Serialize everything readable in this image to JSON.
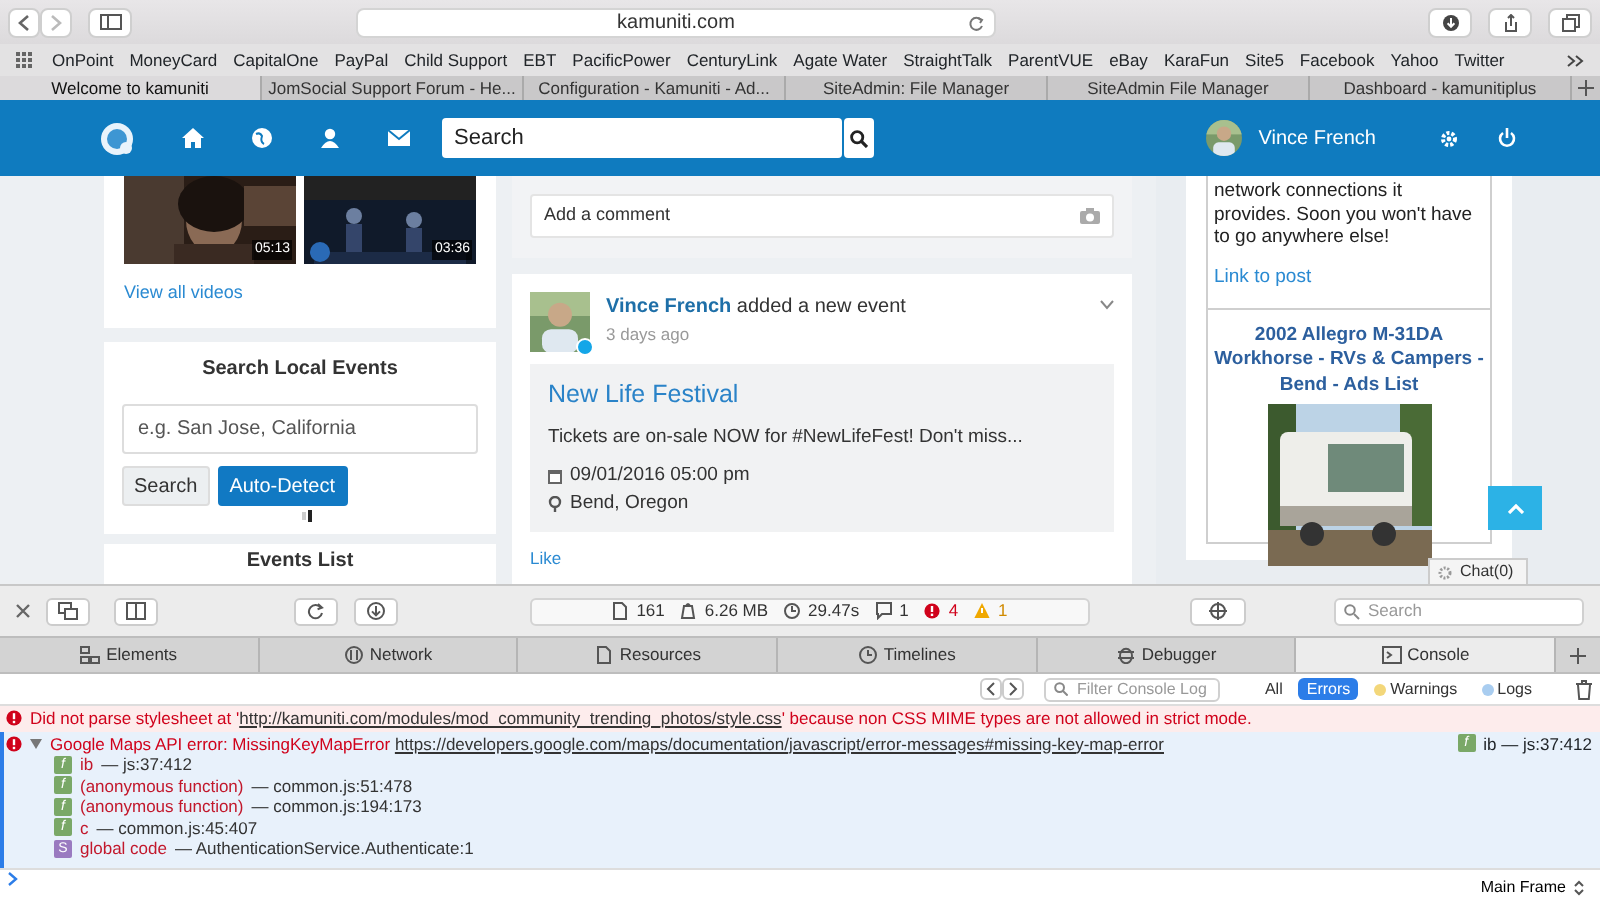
{
  "browser": {
    "url": "kamuniti.com",
    "bookmarks": [
      "OnPoint",
      "MoneyCard",
      "CapitalOne",
      "PayPal",
      "Child Support",
      "EBT",
      "PacificPower",
      "CenturyLink",
      "Agate Water",
      "StraightTalk",
      "ParentVUE",
      "eBay",
      "KaraFun",
      "Site5",
      "Facebook",
      "Yahoo",
      "Twitter"
    ],
    "tabs": [
      {
        "label": "Welcome to kamuniti",
        "selected": true
      },
      {
        "label": "JomSocial Support Forum - He...",
        "selected": false
      },
      {
        "label": "Configuration - Kamuniti - Ad...",
        "selected": false
      },
      {
        "label": "SiteAdmin: File Manager",
        "selected": false
      },
      {
        "label": "SiteAdmin File Manager",
        "selected": false
      },
      {
        "label": "Dashboard - kamunitiplus",
        "selected": false
      }
    ]
  },
  "site_nav": {
    "search_placeholder": "Search",
    "user_name": "Vince French"
  },
  "videos": {
    "items": [
      {
        "duration": "05:13"
      },
      {
        "duration": "03:36"
      }
    ],
    "link": "View all videos"
  },
  "search_events": {
    "title": "Search Local Events",
    "placeholder": "e.g. San Jose, California",
    "buttons": [
      {
        "label": "Search",
        "kind": "default"
      },
      {
        "label": "Auto-Detect",
        "kind": "primary"
      }
    ]
  },
  "events_list": {
    "title": "Events List"
  },
  "comment_box": {
    "placeholder": "Add a comment"
  },
  "post": {
    "author": "Vince French",
    "action": "added a new event",
    "time": "3 days ago",
    "online": true,
    "event": {
      "title": "New Life Festival",
      "description": "Tickets are on-sale NOW for #NewLifeFest! Don't miss...",
      "date": "09/01/2016 05:00 pm",
      "location": "Bend, Oregon"
    },
    "like": "Like"
  },
  "sidebar": {
    "text": "network connections it provides. Soon you won't have to go anywhere else!",
    "link": "Link to post",
    "ad_title": "2002 Allegro M-31DA Workhorse - RVs & Campers - Bend - Ads List"
  },
  "chat": {
    "label": "Chat(0)"
  },
  "devtools": {
    "stats": [
      {
        "kind": "resources",
        "text": "161"
      },
      {
        "kind": "size",
        "text": "6.26 MB"
      },
      {
        "kind": "time",
        "text": "29.47s"
      },
      {
        "kind": "logs",
        "text": "1"
      },
      {
        "kind": "errors",
        "text": "4"
      },
      {
        "kind": "warnings",
        "text": "1"
      }
    ],
    "search_placeholder": "Search",
    "tabs": [
      {
        "label": "Elements",
        "selected": false
      },
      {
        "label": "Network",
        "selected": false
      },
      {
        "label": "Resources",
        "selected": false
      },
      {
        "label": "Timelines",
        "selected": false
      },
      {
        "label": "Debugger",
        "selected": false
      },
      {
        "label": "Console",
        "selected": true
      }
    ],
    "filter_placeholder": "Filter Console Log",
    "filters": [
      {
        "label": "All",
        "selected": false
      },
      {
        "label": "Errors",
        "selected": true
      },
      {
        "label": "Warnings",
        "selected": false,
        "color": "#f3d77a"
      },
      {
        "label": "Logs",
        "selected": false,
        "color": "#a9cdf0"
      }
    ],
    "messages": [
      {
        "kind": "error",
        "text_before": "Did not parse stylesheet at '",
        "url": "http://kamuniti.com/modules/mod_community_trending_photos/style.css",
        "text_after": "' because non CSS MIME types are not allowed in strict mode."
      },
      {
        "kind": "error",
        "expanded": true,
        "text_before": "Google Maps API error: MissingKeyMapError",
        "url": "https://developers.google.com/maps/documentation/javascript/error-messages#missing-key-map-error",
        "source_badge": "f",
        "source": "ib — js:37:412",
        "frames": [
          {
            "badge": "f",
            "kind": "function",
            "name": "ib",
            "location": "— js:37:412"
          },
          {
            "badge": "f",
            "kind": "function",
            "name": "(anonymous function)",
            "location": "— common.js:51:478"
          },
          {
            "badge": "f",
            "kind": "function",
            "name": "(anonymous function)",
            "location": "— common.js:194:173"
          },
          {
            "badge": "f",
            "kind": "function",
            "name": "c",
            "location": "— common.js:45:407"
          },
          {
            "badge": "S",
            "kind": "script",
            "name": "global code",
            "location": "— AuthenticationService.Authenticate:1"
          }
        ]
      }
    ],
    "context": "Main Frame"
  }
}
